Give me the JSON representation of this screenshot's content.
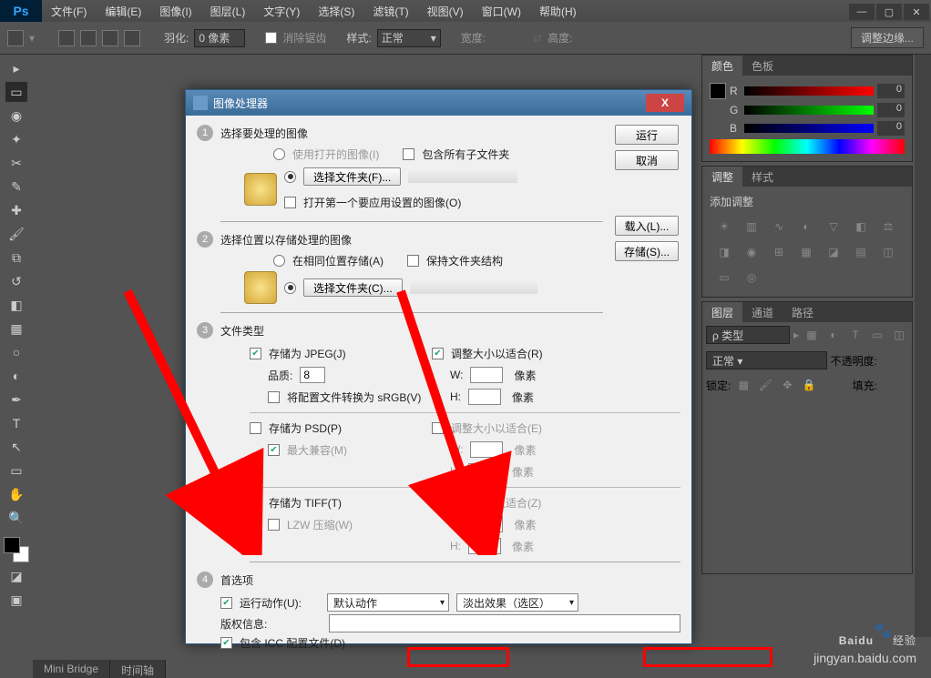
{
  "menubar": [
    "文件(F)",
    "编辑(E)",
    "图像(I)",
    "图层(L)",
    "文字(Y)",
    "选择(S)",
    "滤镜(T)",
    "视图(V)",
    "窗口(W)",
    "帮助(H)"
  ],
  "options": {
    "feather_label": "羽化:",
    "feather_value": "0 像素",
    "antialias": "消除锯齿",
    "style_label": "样式:",
    "style_value": "正常",
    "width_label": "宽度:",
    "height_label": "高度:",
    "refine": "调整边缘..."
  },
  "panels": {
    "color_tabs": [
      "颜色",
      "色板"
    ],
    "rgb": {
      "r": "0",
      "g": "0",
      "b": "0"
    },
    "adjust_tabs": [
      "调整",
      "样式"
    ],
    "adjust_title": "添加调整",
    "layer_tabs": [
      "图层",
      "通道",
      "路径"
    ],
    "layer_type": "ρ 类型",
    "blend_mode": "正常",
    "opacity_label": "不透明度:",
    "lock_label": "锁定:",
    "fill_label": "填充:"
  },
  "bottom_tabs": [
    "Mini Bridge",
    "时间轴"
  ],
  "dialog": {
    "title": "图像处理器",
    "close": "X",
    "buttons": {
      "run": "运行",
      "cancel": "取消",
      "load": "载入(L)...",
      "save": "存储(S)..."
    },
    "sec1": {
      "title": "选择要处理的图像",
      "use_open": "使用打开的图像(I)",
      "include_sub": "包含所有子文件夹",
      "select_folder": "选择文件夹(F)...",
      "open_first": "打开第一个要应用设置的图像(O)"
    },
    "sec2": {
      "title": "选择位置以存储处理的图像",
      "same_loc": "在相同位置存储(A)",
      "keep_struct": "保持文件夹结构",
      "select_folder": "选择文件夹(C)..."
    },
    "sec3": {
      "title": "文件类型",
      "jpeg": "存储为 JPEG(J)",
      "quality_label": "品质:",
      "quality_value": "8",
      "srgb": "将配置文件转换为 sRGB(V)",
      "resize_r": "调整大小以适合(R)",
      "w_label": "W:",
      "h_label": "H:",
      "px": "像素",
      "psd": "存储为 PSD(P)",
      "max_compat": "最大兼容(M)",
      "resize_e": "调整大小以适合(E)",
      "tiff": "存储为 TIFF(T)",
      "lzw": "LZW 压缩(W)",
      "resize_z": "调整大小以适合(Z)"
    },
    "sec4": {
      "title": "首选项",
      "run_action": "运行动作(U):",
      "action_set": "默认动作",
      "action_name": "淡出效果（选区）",
      "copyright_label": "版权信息:",
      "include_icc": "包含 ICC 配置文件(D)"
    }
  },
  "watermark": {
    "brand": "Baidu",
    "suffix": "经验",
    "url": "jingyan.baidu.com"
  }
}
